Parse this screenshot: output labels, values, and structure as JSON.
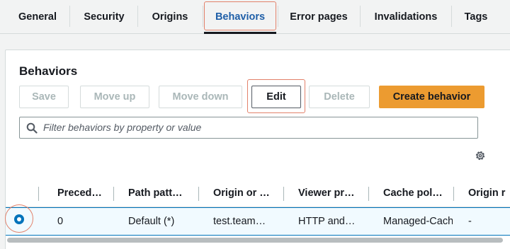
{
  "tabs": [
    {
      "label": "General"
    },
    {
      "label": "Security"
    },
    {
      "label": "Origins"
    },
    {
      "label": "Behaviors",
      "active": true
    },
    {
      "label": "Error pages"
    },
    {
      "label": "Invalidations"
    },
    {
      "label": "Tags"
    }
  ],
  "panel": {
    "title": "Behaviors",
    "buttons": {
      "save": "Save",
      "move_up": "Move up",
      "move_down": "Move down",
      "edit": "Edit",
      "delete": "Delete",
      "create": "Create behavior"
    },
    "search": {
      "placeholder": "Filter behaviors by property or value"
    },
    "icons": {
      "search": "search-icon",
      "settings": "gear-icon"
    }
  },
  "table": {
    "columns": [
      "Preced…",
      "Path patt…",
      "Origin or …",
      "Viewer pr…",
      "Cache pol…",
      "Origin r"
    ],
    "rows": [
      {
        "selected": true,
        "cells": [
          "0",
          "Default (*)",
          "test.team…",
          "HTTP and…",
          "Managed-Cachin",
          "-"
        ]
      }
    ]
  },
  "colors": {
    "accent": "#0073bb",
    "primary_button": "#ec9b30",
    "active_tab": "#1f5fa8",
    "highlight": "#e2816a"
  }
}
